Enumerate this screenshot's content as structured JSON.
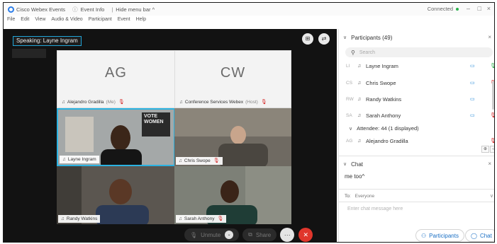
{
  "window": {
    "app_title": "Cisco Webex Events",
    "event_info": "Event Info",
    "hide_menu": "Hide menu bar ^",
    "status": "Connected"
  },
  "menu": [
    "File",
    "Edit",
    "View",
    "Audio & Video",
    "Participant",
    "Event",
    "Help"
  ],
  "stage": {
    "speaking": "Speaking: Layne Ingram",
    "tiles": [
      {
        "initials": "AG",
        "name": "Alejandro Gradilla",
        "role": "(Me)"
      },
      {
        "initials": "CW",
        "name": "Conference Services Webex",
        "role": "(Host)"
      },
      {
        "name": "Layne Ingram",
        "sign": "VOTE\nWOMEN"
      },
      {
        "name": "Chris Swope"
      },
      {
        "name": "Randy Watkins"
      },
      {
        "name": "Sarah Anthony"
      }
    ]
  },
  "controls": {
    "unmute": "Unmute",
    "share": "Share",
    "more": "···",
    "end": "✕"
  },
  "participants": {
    "header": "Participants (49)",
    "search_placeholder": "Search",
    "panelists": [
      {
        "initials": "LI",
        "name": "Layne Ingram"
      },
      {
        "initials": "CS",
        "name": "Chris Swope"
      },
      {
        "initials": "RW",
        "name": "Randy Watkins"
      },
      {
        "initials": "SA",
        "name": "Sarah Anthony"
      }
    ],
    "attendees_header": "Attendee: 44 (1 displayed)",
    "attendees": [
      {
        "initials": "AG",
        "name": "Alejandro Gradilla"
      }
    ]
  },
  "chat": {
    "header": "Chat",
    "message": "me too^",
    "to_label": "To:",
    "to_value": "Everyone",
    "input_placeholder": "Enter chat message here"
  },
  "footer": {
    "participants_btn": "Participants",
    "chat_btn": "Chat"
  },
  "colors": {
    "accent": "#2bb3e2",
    "mute_red": "#d42020",
    "end_red": "#e0362c",
    "link_blue": "#1a6fc4"
  }
}
